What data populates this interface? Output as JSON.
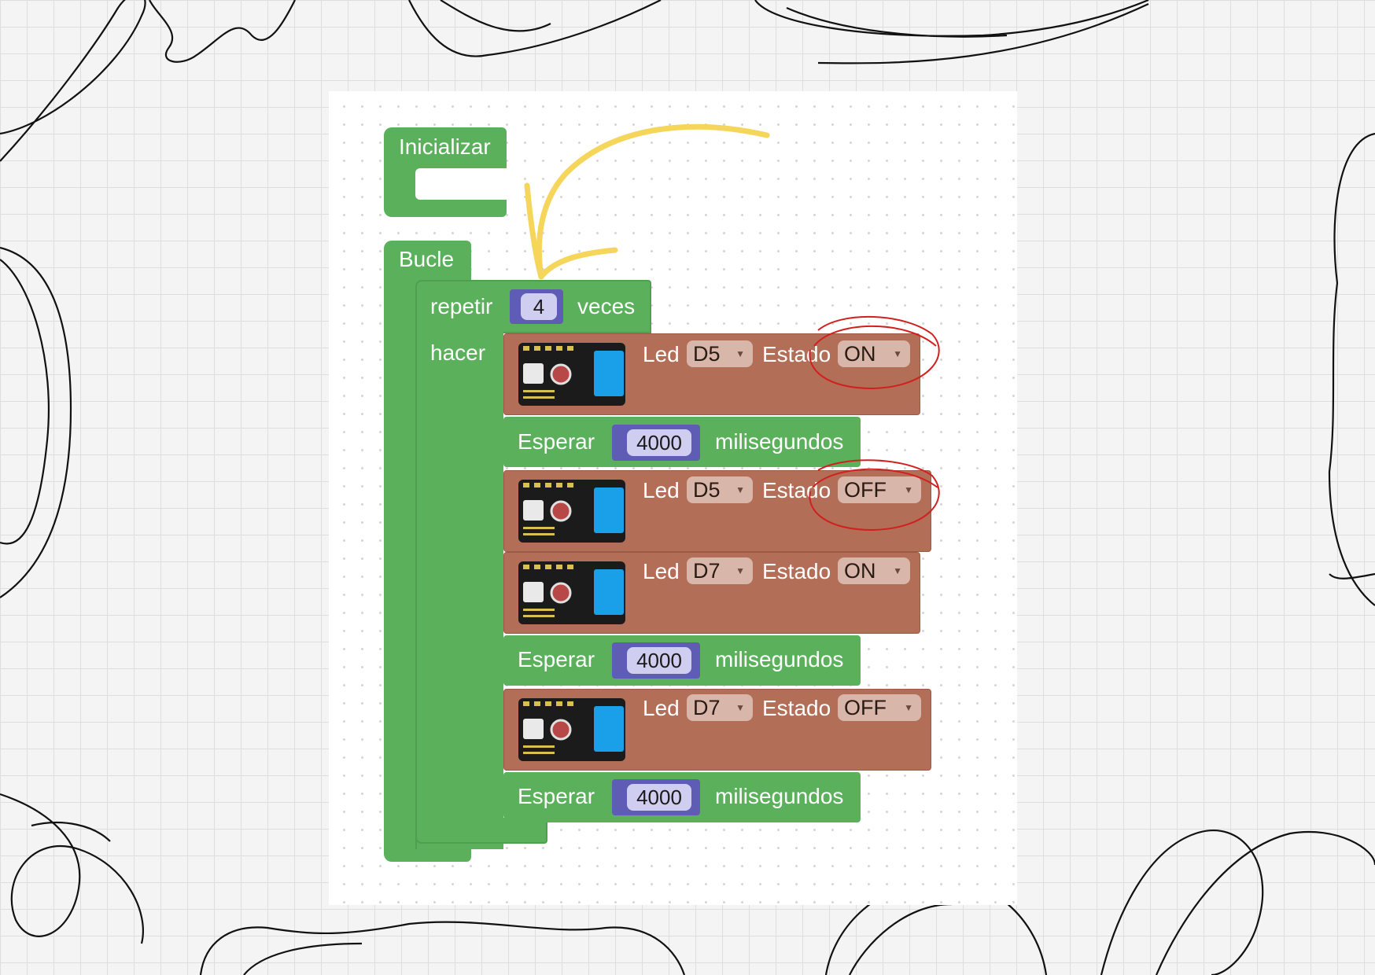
{
  "blocks": {
    "init": {
      "label": "Inicializar"
    },
    "loop": {
      "label": "Bucle"
    },
    "repeat": {
      "label_before": "repetir",
      "count": "4",
      "label_after": "veces",
      "do_label": "hacer"
    },
    "statements": [
      {
        "kind": "led",
        "led_label": "Led",
        "pin": "D5",
        "state_label": "Estado",
        "state": "ON"
      },
      {
        "kind": "wait",
        "label": "Esperar",
        "value": "4000",
        "unit": "milisegundos"
      },
      {
        "kind": "led",
        "led_label": "Led",
        "pin": "D5",
        "state_label": "Estado",
        "state": "OFF"
      },
      {
        "kind": "led",
        "led_label": "Led",
        "pin": "D7",
        "state_label": "Estado",
        "state": "ON"
      },
      {
        "kind": "wait",
        "label": "Esperar",
        "value": "4000",
        "unit": "milisegundos"
      },
      {
        "kind": "led",
        "led_label": "Led",
        "pin": "D7",
        "state_label": "Estado",
        "state": "OFF"
      },
      {
        "kind": "wait",
        "label": "Esperar",
        "value": "4000",
        "unit": "milisegundos"
      }
    ]
  },
  "icons": {
    "led_module": "led-module-icon",
    "dropdown": "dropdown-arrow-icon",
    "arrow_annotation": "yellow-arrow-annotation",
    "circle_annotation": "red-circle-annotation"
  },
  "colors": {
    "control_block": "#5bb05b",
    "led_block": "#b36e57",
    "number_block": "#5f5cb6",
    "arrow": "#f5d55a",
    "circle": "#d02020"
  }
}
